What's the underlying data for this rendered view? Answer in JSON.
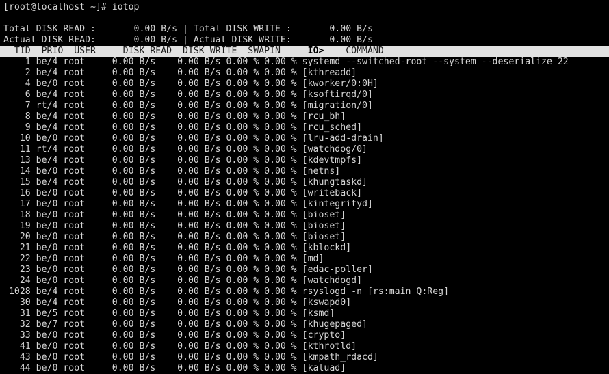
{
  "terminal": {
    "title": "iotop",
    "background_color": "#000000",
    "foreground_color": "#d4d4d4",
    "header_background_color": "#e2e2e2",
    "header_foreground_color": "#1a1a1a"
  },
  "prompt": {
    "text": "[root@localhost ~]# iotop"
  },
  "summary": {
    "line1": {
      "read_label": "Total DISK READ :",
      "read_value": "0.00 B/s",
      "separator": "|",
      "write_label": "Total DISK WRITE :",
      "write_value": "0.00 B/s",
      "full": "Total DISK READ :       0.00 B/s | Total DISK WRITE :       0.00 B/s"
    },
    "line2": {
      "read_label": "Actual DISK READ:",
      "read_value": "0.00 B/s",
      "separator": "|",
      "write_label": "Actual DISK WRITE:",
      "write_value": "0.00 B/s",
      "full": "Actual DISK READ:       0.00 B/s | Actual DISK WRITE:       0.00 B/s"
    }
  },
  "table": {
    "columns": [
      "TID",
      "PRIO",
      "USER",
      "DISK READ",
      "DISK WRITE",
      "SWAPIN",
      "IO>",
      "COMMAND"
    ],
    "sort_column": "IO>",
    "header_pre": "  TID  PRIO  USER     DISK READ  DISK WRITE  SWAPIN     ",
    "header_sort": "IO>",
    "header_post": "    COMMAND",
    "rows": [
      {
        "tid": "1",
        "prio": "be/4",
        "user": "root",
        "disk_read": "0.00 B/s",
        "disk_write": "0.00 B/s",
        "swapin": "0.00 %",
        "io": "0.00 %",
        "command": "systemd --switched-root --system --deserialize 22"
      },
      {
        "tid": "2",
        "prio": "be/4",
        "user": "root",
        "disk_read": "0.00 B/s",
        "disk_write": "0.00 B/s",
        "swapin": "0.00 %",
        "io": "0.00 %",
        "command": "[kthreadd]"
      },
      {
        "tid": "4",
        "prio": "be/0",
        "user": "root",
        "disk_read": "0.00 B/s",
        "disk_write": "0.00 B/s",
        "swapin": "0.00 %",
        "io": "0.00 %",
        "command": "[kworker/0:0H]"
      },
      {
        "tid": "6",
        "prio": "be/4",
        "user": "root",
        "disk_read": "0.00 B/s",
        "disk_write": "0.00 B/s",
        "swapin": "0.00 %",
        "io": "0.00 %",
        "command": "[ksoftirqd/0]"
      },
      {
        "tid": "7",
        "prio": "rt/4",
        "user": "root",
        "disk_read": "0.00 B/s",
        "disk_write": "0.00 B/s",
        "swapin": "0.00 %",
        "io": "0.00 %",
        "command": "[migration/0]"
      },
      {
        "tid": "8",
        "prio": "be/4",
        "user": "root",
        "disk_read": "0.00 B/s",
        "disk_write": "0.00 B/s",
        "swapin": "0.00 %",
        "io": "0.00 %",
        "command": "[rcu_bh]"
      },
      {
        "tid": "9",
        "prio": "be/4",
        "user": "root",
        "disk_read": "0.00 B/s",
        "disk_write": "0.00 B/s",
        "swapin": "0.00 %",
        "io": "0.00 %",
        "command": "[rcu_sched]"
      },
      {
        "tid": "10",
        "prio": "be/0",
        "user": "root",
        "disk_read": "0.00 B/s",
        "disk_write": "0.00 B/s",
        "swapin": "0.00 %",
        "io": "0.00 %",
        "command": "[lru-add-drain]"
      },
      {
        "tid": "11",
        "prio": "rt/4",
        "user": "root",
        "disk_read": "0.00 B/s",
        "disk_write": "0.00 B/s",
        "swapin": "0.00 %",
        "io": "0.00 %",
        "command": "[watchdog/0]"
      },
      {
        "tid": "13",
        "prio": "be/4",
        "user": "root",
        "disk_read": "0.00 B/s",
        "disk_write": "0.00 B/s",
        "swapin": "0.00 %",
        "io": "0.00 %",
        "command": "[kdevtmpfs]"
      },
      {
        "tid": "14",
        "prio": "be/0",
        "user": "root",
        "disk_read": "0.00 B/s",
        "disk_write": "0.00 B/s",
        "swapin": "0.00 %",
        "io": "0.00 %",
        "command": "[netns]"
      },
      {
        "tid": "15",
        "prio": "be/4",
        "user": "root",
        "disk_read": "0.00 B/s",
        "disk_write": "0.00 B/s",
        "swapin": "0.00 %",
        "io": "0.00 %",
        "command": "[khungtaskd]"
      },
      {
        "tid": "16",
        "prio": "be/0",
        "user": "root",
        "disk_read": "0.00 B/s",
        "disk_write": "0.00 B/s",
        "swapin": "0.00 %",
        "io": "0.00 %",
        "command": "[writeback]"
      },
      {
        "tid": "17",
        "prio": "be/0",
        "user": "root",
        "disk_read": "0.00 B/s",
        "disk_write": "0.00 B/s",
        "swapin": "0.00 %",
        "io": "0.00 %",
        "command": "[kintegrityd]"
      },
      {
        "tid": "18",
        "prio": "be/0",
        "user": "root",
        "disk_read": "0.00 B/s",
        "disk_write": "0.00 B/s",
        "swapin": "0.00 %",
        "io": "0.00 %",
        "command": "[bioset]"
      },
      {
        "tid": "19",
        "prio": "be/0",
        "user": "root",
        "disk_read": "0.00 B/s",
        "disk_write": "0.00 B/s",
        "swapin": "0.00 %",
        "io": "0.00 %",
        "command": "[bioset]"
      },
      {
        "tid": "20",
        "prio": "be/0",
        "user": "root",
        "disk_read": "0.00 B/s",
        "disk_write": "0.00 B/s",
        "swapin": "0.00 %",
        "io": "0.00 %",
        "command": "[bioset]"
      },
      {
        "tid": "21",
        "prio": "be/0",
        "user": "root",
        "disk_read": "0.00 B/s",
        "disk_write": "0.00 B/s",
        "swapin": "0.00 %",
        "io": "0.00 %",
        "command": "[kblockd]"
      },
      {
        "tid": "22",
        "prio": "be/0",
        "user": "root",
        "disk_read": "0.00 B/s",
        "disk_write": "0.00 B/s",
        "swapin": "0.00 %",
        "io": "0.00 %",
        "command": "[md]"
      },
      {
        "tid": "23",
        "prio": "be/0",
        "user": "root",
        "disk_read": "0.00 B/s",
        "disk_write": "0.00 B/s",
        "swapin": "0.00 %",
        "io": "0.00 %",
        "command": "[edac-poller]"
      },
      {
        "tid": "24",
        "prio": "be/0",
        "user": "root",
        "disk_read": "0.00 B/s",
        "disk_write": "0.00 B/s",
        "swapin": "0.00 %",
        "io": "0.00 %",
        "command": "[watchdogd]"
      },
      {
        "tid": "1028",
        "prio": "be/4",
        "user": "root",
        "disk_read": "0.00 B/s",
        "disk_write": "0.00 B/s",
        "swapin": "0.00 %",
        "io": "0.00 %",
        "command": "rsyslogd -n [rs:main Q:Reg]"
      },
      {
        "tid": "30",
        "prio": "be/4",
        "user": "root",
        "disk_read": "0.00 B/s",
        "disk_write": "0.00 B/s",
        "swapin": "0.00 %",
        "io": "0.00 %",
        "command": "[kswapd0]"
      },
      {
        "tid": "31",
        "prio": "be/5",
        "user": "root",
        "disk_read": "0.00 B/s",
        "disk_write": "0.00 B/s",
        "swapin": "0.00 %",
        "io": "0.00 %",
        "command": "[ksmd]"
      },
      {
        "tid": "32",
        "prio": "be/7",
        "user": "root",
        "disk_read": "0.00 B/s",
        "disk_write": "0.00 B/s",
        "swapin": "0.00 %",
        "io": "0.00 %",
        "command": "[khugepaged]"
      },
      {
        "tid": "33",
        "prio": "be/0",
        "user": "root",
        "disk_read": "0.00 B/s",
        "disk_write": "0.00 B/s",
        "swapin": "0.00 %",
        "io": "0.00 %",
        "command": "[crypto]"
      },
      {
        "tid": "41",
        "prio": "be/0",
        "user": "root",
        "disk_read": "0.00 B/s",
        "disk_write": "0.00 B/s",
        "swapin": "0.00 %",
        "io": "0.00 %",
        "command": "[kthrotld]"
      },
      {
        "tid": "43",
        "prio": "be/0",
        "user": "root",
        "disk_read": "0.00 B/s",
        "disk_write": "0.00 B/s",
        "swapin": "0.00 %",
        "io": "0.00 %",
        "command": "[kmpath_rdacd]"
      },
      {
        "tid": "44",
        "prio": "be/0",
        "user": "root",
        "disk_read": "0.00 B/s",
        "disk_write": "0.00 B/s",
        "swapin": "0.00 %",
        "io": "0.00 %",
        "command": "[kaluad]"
      }
    ]
  }
}
